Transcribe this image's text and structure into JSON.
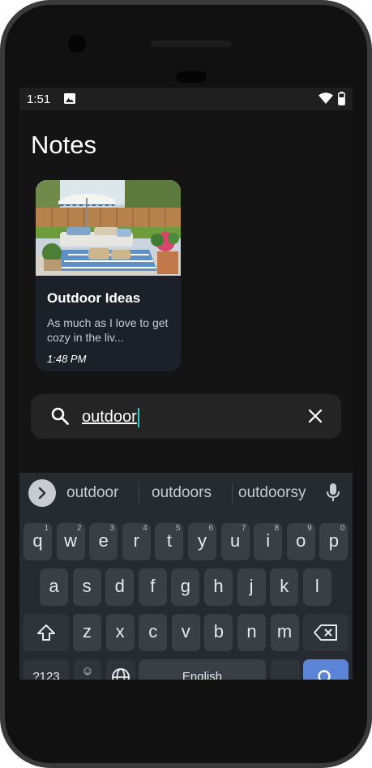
{
  "status_bar": {
    "time": "1:51"
  },
  "header": {
    "title": "Notes"
  },
  "notes": [
    {
      "title": "Outdoor Ideas",
      "snippet": "As much as I love to get cozy in the liv...",
      "time": "1:48 PM"
    }
  ],
  "search": {
    "value": "outdoor"
  },
  "keyboard": {
    "suggestions": [
      "outdoor",
      "outdoors",
      "outdoorsy"
    ],
    "row1": [
      {
        "key": "q",
        "hint": "1"
      },
      {
        "key": "w",
        "hint": "2"
      },
      {
        "key": "e",
        "hint": "3"
      },
      {
        "key": "r",
        "hint": "4"
      },
      {
        "key": "t",
        "hint": "5"
      },
      {
        "key": "y",
        "hint": "6"
      },
      {
        "key": "u",
        "hint": "7"
      },
      {
        "key": "i",
        "hint": "8"
      },
      {
        "key": "o",
        "hint": "9"
      },
      {
        "key": "p",
        "hint": "0"
      }
    ],
    "row2": [
      "a",
      "s",
      "d",
      "f",
      "g",
      "h",
      "j",
      "k",
      "l"
    ],
    "row3": [
      "z",
      "x",
      "c",
      "v",
      "b",
      "n",
      "m"
    ],
    "symbols_label": "?123",
    "emoji_label": "☺",
    "space_label": "English"
  },
  "colors": {
    "background": "#141414",
    "card": "#1c2029",
    "search_bar": "#242424",
    "cursor": "#2fd0c4",
    "keyboard": "#262b32",
    "key": "#3a3f46",
    "action_key": "#5b83d6"
  }
}
